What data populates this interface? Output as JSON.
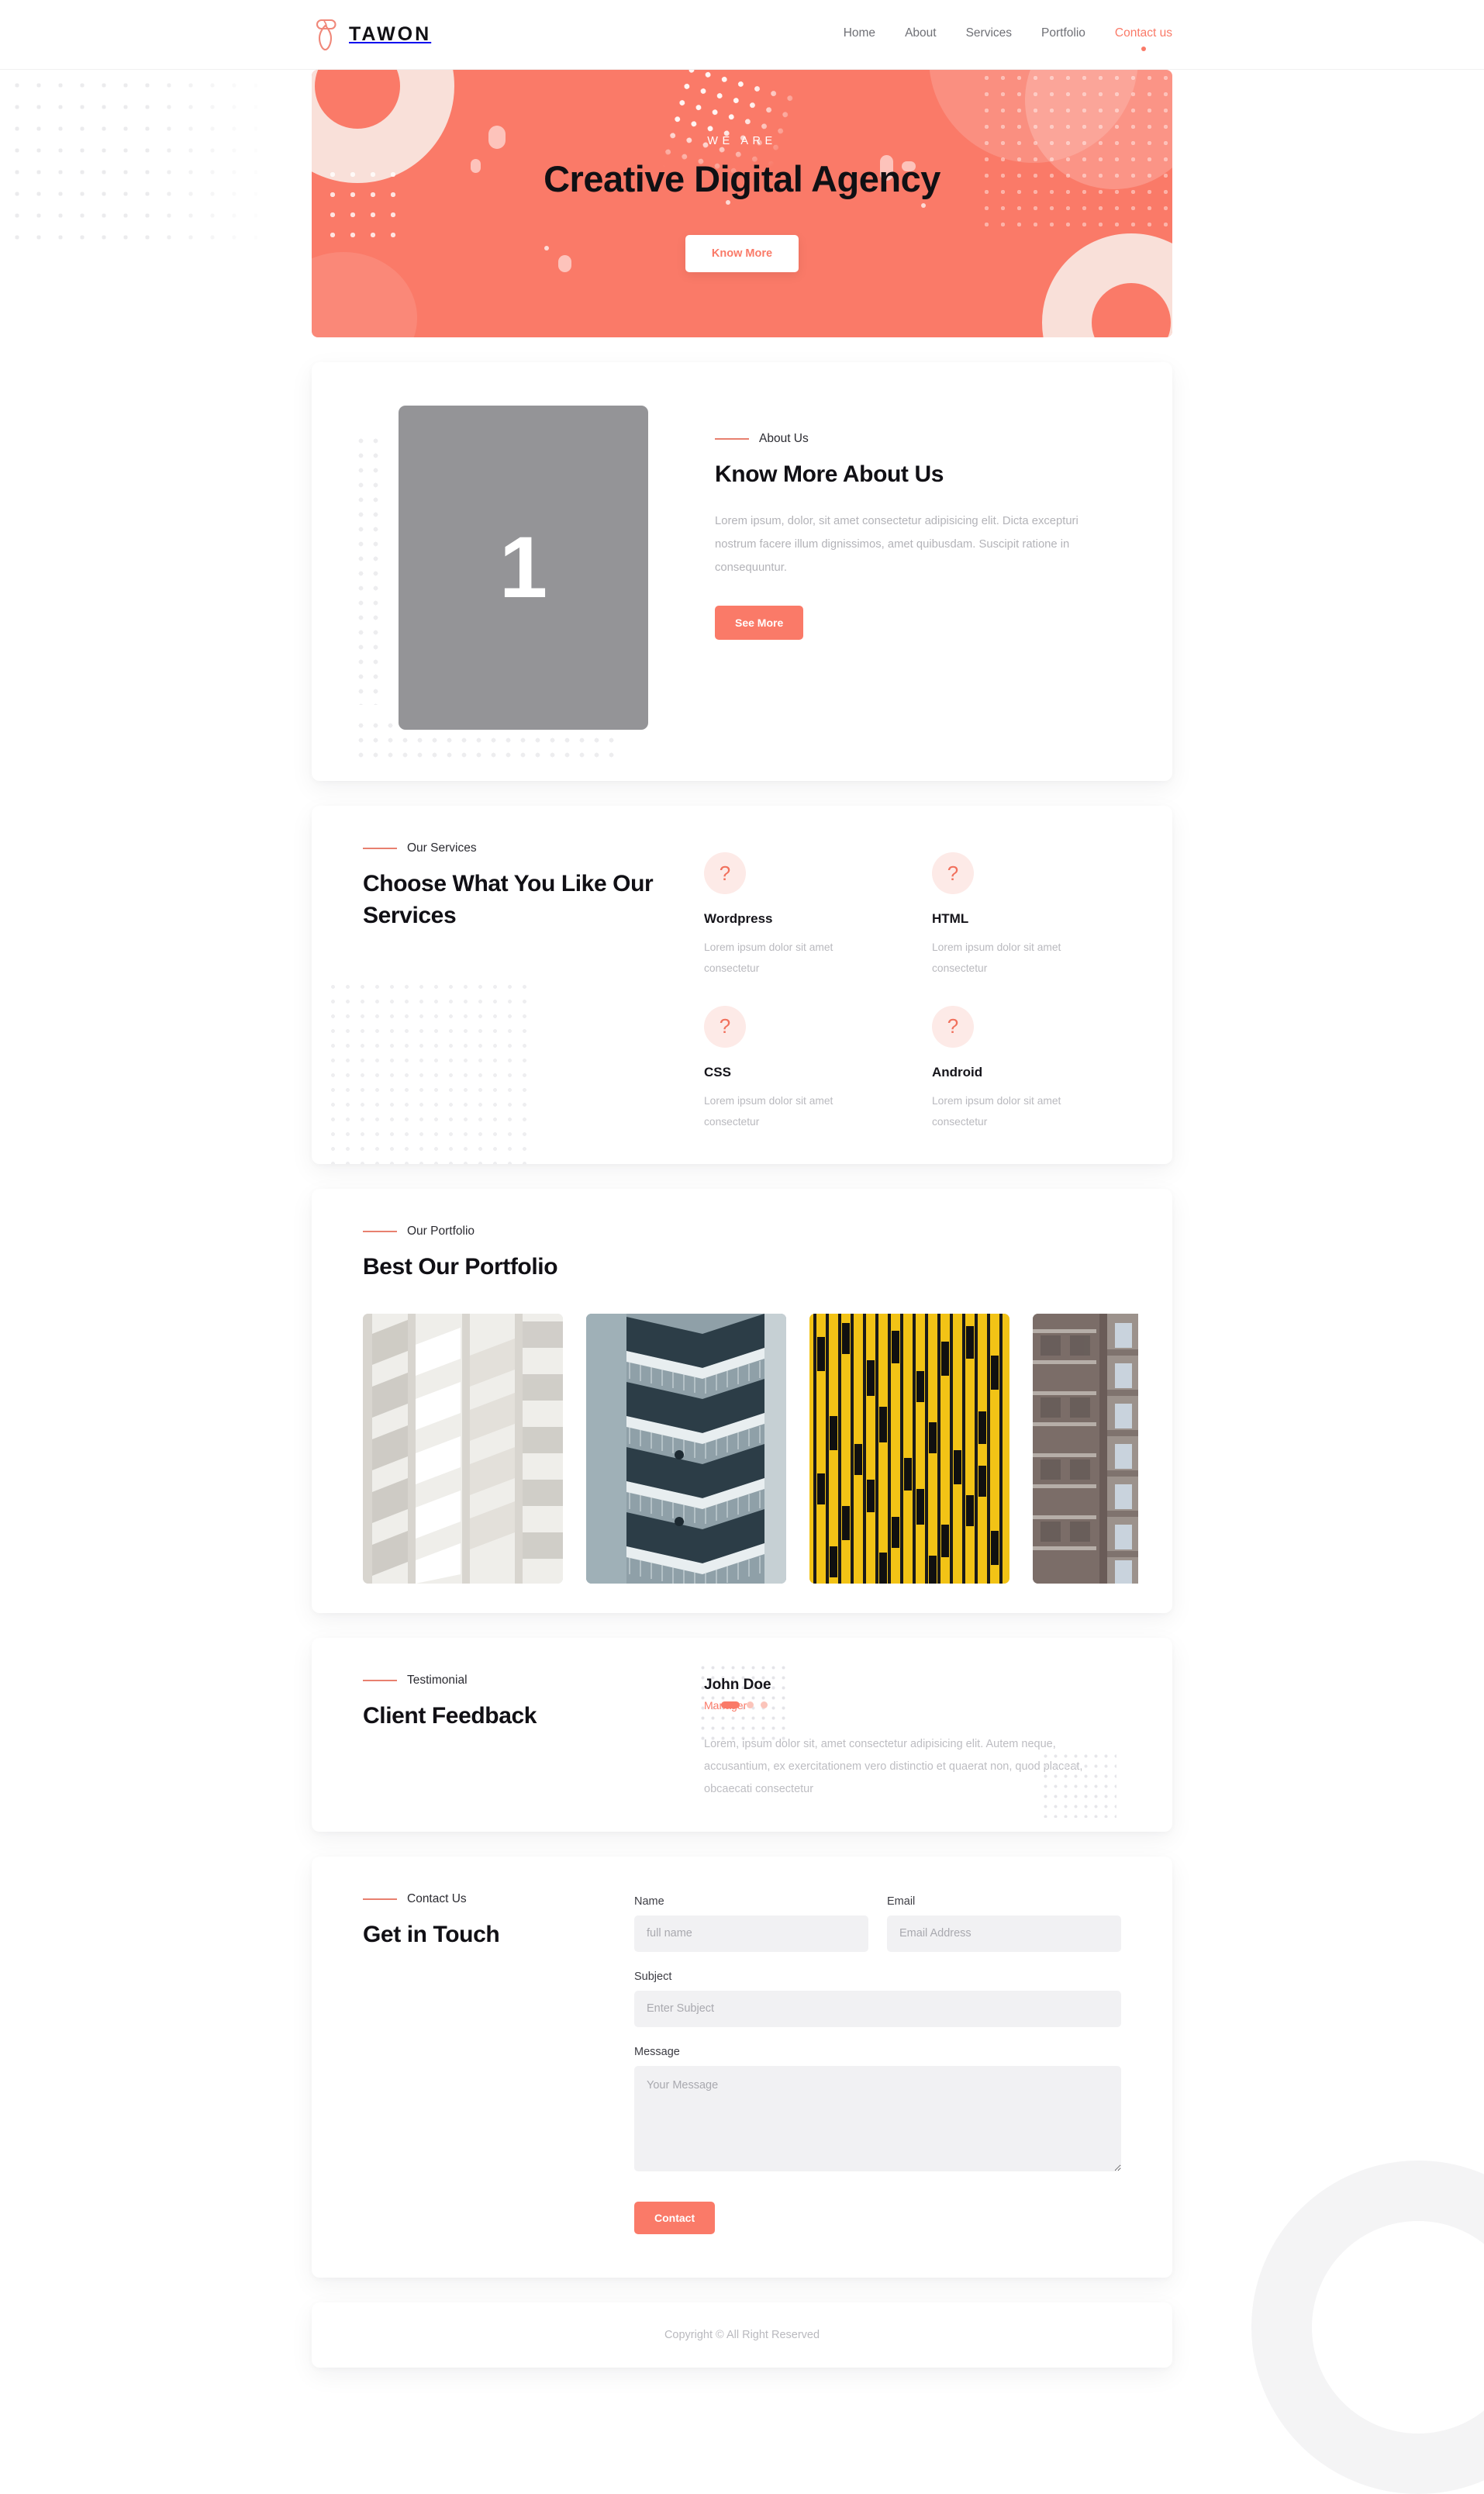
{
  "theme": {
    "accent": "#fa7a68",
    "accent_soft": "#fdeae7",
    "ink": "#111015",
    "muted": "#b3b3b8",
    "page_bg": "#ffffff"
  },
  "header": {
    "logo_icon": "tawon-ribbon-logo",
    "brand": "TAWON",
    "nav": [
      {
        "label": "Home",
        "active": false
      },
      {
        "label": "About",
        "active": false
      },
      {
        "label": "Services",
        "active": false
      },
      {
        "label": "Portfolio",
        "active": false
      },
      {
        "label": "Contact us",
        "active": true
      }
    ]
  },
  "hero": {
    "eyebrow": "WE ARE",
    "title": "Creative Digital Agency",
    "cta": "Know More"
  },
  "about": {
    "eyebrow": "About Us",
    "title": "Know More About Us",
    "image_placeholder": "1",
    "paragraph": "Lorem ipsum, dolor, sit amet consectetur adipisicing elit. Dicta excepturi nostrum facere illum dignissimos, amet quibusdam. Suscipit ratione in consequuntur.",
    "cta": "See More"
  },
  "services": {
    "eyebrow": "Our Services",
    "title": "Choose What You Like Our Services",
    "items": [
      {
        "icon": "broken-image-icon",
        "glyph": "?",
        "name": "Wordpress",
        "desc": "Lorem ipsum dolor sit amet consectetur"
      },
      {
        "icon": "broken-image-icon",
        "glyph": "?",
        "name": "HTML",
        "desc": "Lorem ipsum dolor sit amet consectetur"
      },
      {
        "icon": "broken-image-icon",
        "glyph": "?",
        "name": "CSS",
        "desc": "Lorem ipsum dolor sit amet consectetur"
      },
      {
        "icon": "broken-image-icon",
        "glyph": "?",
        "name": "Android",
        "desc": "Lorem ipsum dolor sit amet consectetur"
      }
    ]
  },
  "portfolio": {
    "eyebrow": "Our Portfolio",
    "title": "Best Our Portfolio",
    "items": [
      {
        "alt": "white-apartment-balconies",
        "palette": [
          "#f2f1ee",
          "#d9d7d2",
          "#bdbab3"
        ]
      },
      {
        "alt": "dark-teal-zigzag-balconies",
        "palette": [
          "#2e3f48",
          "#7d8f97",
          "#dfe6e8"
        ]
      },
      {
        "alt": "yellow-striped-facade",
        "palette": [
          "#f1c114",
          "#1c1c1c",
          "#f7d64a"
        ]
      },
      {
        "alt": "brown-residential-tower",
        "palette": [
          "#8d7f79",
          "#6d5f5b",
          "#cfd6de"
        ]
      }
    ]
  },
  "testimonial": {
    "eyebrow": "Testimonial",
    "title": "Client Feedback",
    "author": "John Doe",
    "role": "Manager",
    "quote": "Lorem, ipsum dolor sit, amet consectetur adipisicing elit. Autem neque, accusantium, ex exercitationem vero distinctio et quaerat non, quod placeat, obcaecati consectetur",
    "pager": {
      "total": 3,
      "active_index": 0
    }
  },
  "contact": {
    "eyebrow": "Contact Us",
    "title": "Get in Touch",
    "fields": {
      "name": {
        "label": "Name",
        "placeholder": "full name",
        "value": ""
      },
      "email": {
        "label": "Email",
        "placeholder": "Email Address",
        "value": ""
      },
      "subject": {
        "label": "Subject",
        "placeholder": "Enter Subject",
        "value": ""
      },
      "message": {
        "label": "Message",
        "placeholder": "Your Message",
        "value": ""
      }
    },
    "submit": "Contact"
  },
  "footer": {
    "copyright": "Copyright © All Right Reserved"
  }
}
